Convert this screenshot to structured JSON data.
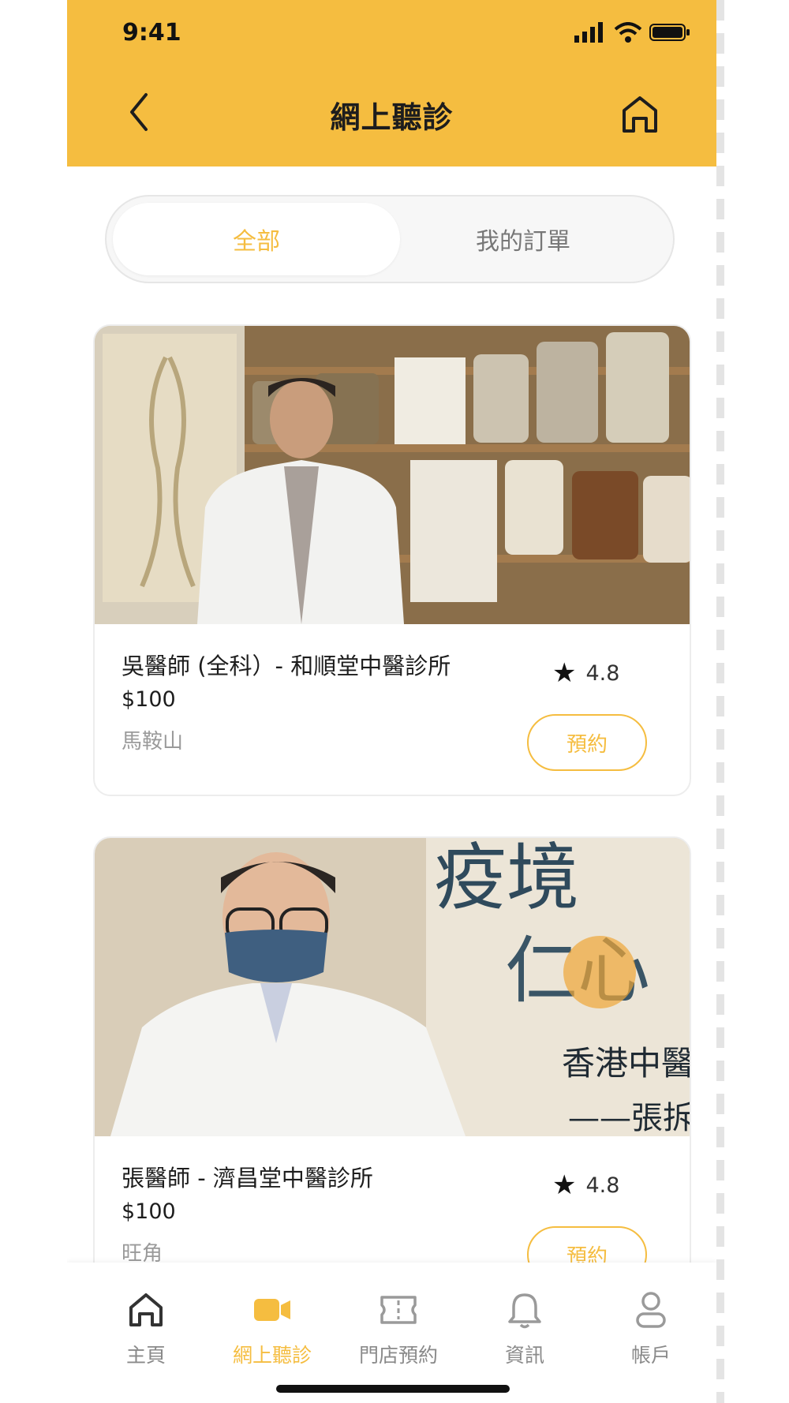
{
  "status": {
    "time": "9:41"
  },
  "header": {
    "title": "網上聽診"
  },
  "segments": {
    "all": "全部",
    "my_orders": "我的訂單"
  },
  "doctors": [
    {
      "name": "吳醫師 (全科）-  和順堂中醫診所",
      "price": "$100",
      "area": "馬鞍山",
      "rating": "4.8",
      "book_label": "預約"
    },
    {
      "name": "張醫師 - 濟昌堂中醫診所",
      "price": "$100",
      "area": "旺角",
      "rating": "4.8",
      "book_label": "預約"
    }
  ],
  "photo2_overlay": {
    "line1": "疫境",
    "line2": "仁心",
    "line3": "香港中醫",
    "line4": "——張拆"
  },
  "tabbar": {
    "items": [
      {
        "label": "主頁",
        "icon": "home-icon"
      },
      {
        "label": "網上聽診",
        "icon": "video-icon"
      },
      {
        "label": "門店預約",
        "icon": "ticket-icon"
      },
      {
        "label": "資訊",
        "icon": "bell-icon"
      },
      {
        "label": "帳戶",
        "icon": "user-icon"
      }
    ]
  },
  "colors": {
    "accent": "#f5bd40",
    "text": "#1d1d1d",
    "muted": "#8a8a8a"
  }
}
